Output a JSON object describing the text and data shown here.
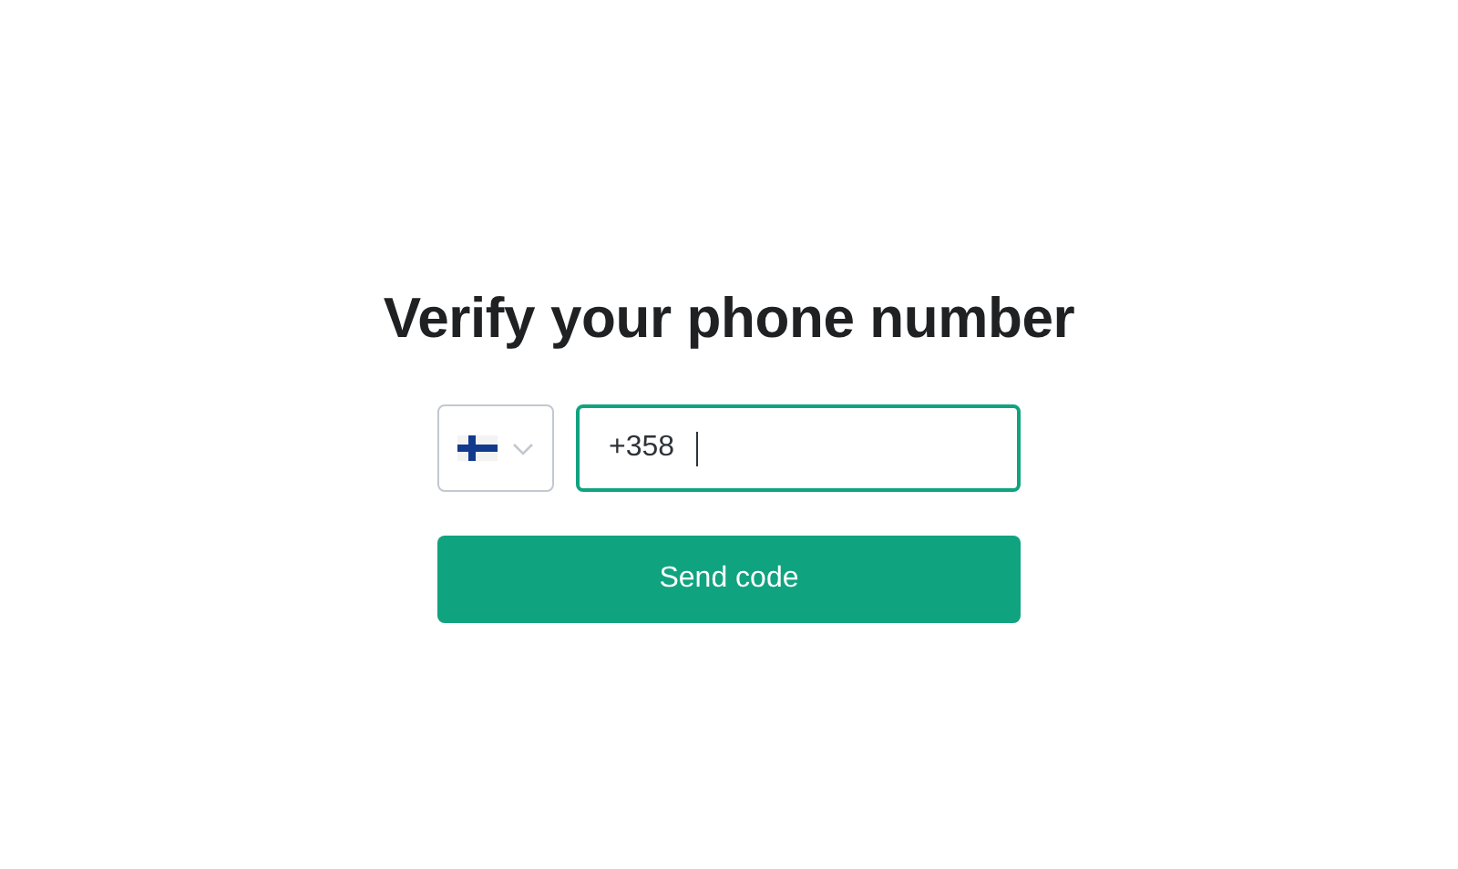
{
  "title": "Verify your phone number",
  "phone_field": {
    "value": "+358",
    "focused": true
  },
  "submit_button": {
    "label": "Send code"
  }
}
